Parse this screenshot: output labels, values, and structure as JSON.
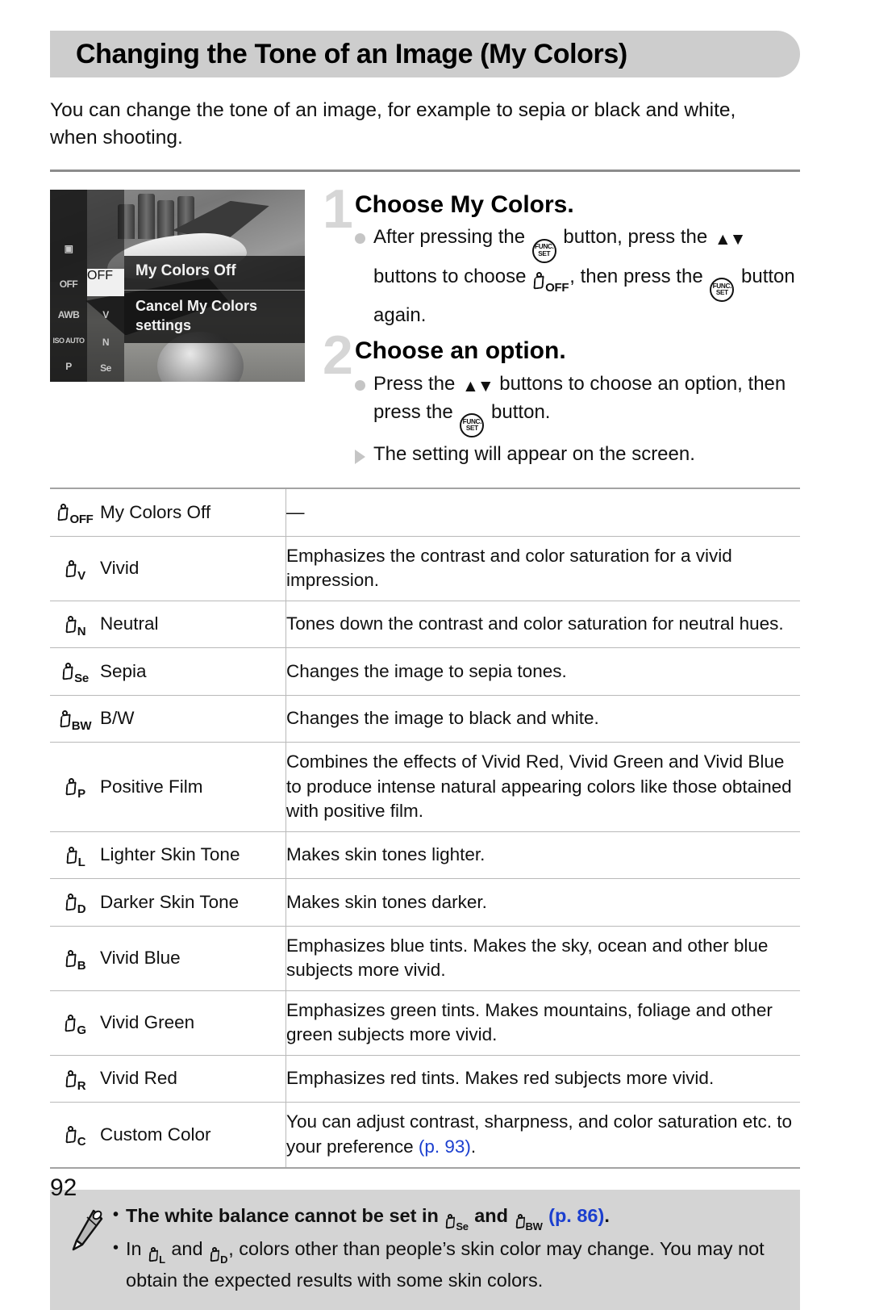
{
  "page": {
    "number": "92",
    "title": "Changing the Tone of an Image (My Colors)",
    "intro": "You can change the tone of an image, for example to sepia or black and white, when shooting."
  },
  "camera_screen": {
    "selected_label": "OFF",
    "menu_title": "My Colors Off",
    "menu_subtitle": "Cancel My Colors settings",
    "left_column_items": [
      "▣",
      "OFF",
      "AWB",
      "ISO AUTO",
      "P"
    ],
    "option_column_items": [
      "OFF",
      "V",
      "N",
      "Se"
    ]
  },
  "steps": [
    {
      "number": "1",
      "title": "Choose My Colors.",
      "bullets": [
        {
          "marker": "dot",
          "parts": [
            {
              "t": "text",
              "v": "After pressing the "
            },
            {
              "t": "funcset"
            },
            {
              "t": "text",
              "v": " button, press the "
            },
            {
              "t": "updown"
            },
            {
              "t": "text",
              "v": " buttons to choose "
            },
            {
              "t": "mc",
              "sub": "OFF"
            },
            {
              "t": "text",
              "v": ", then press the "
            },
            {
              "t": "funcset"
            },
            {
              "t": "text",
              "v": " button again."
            }
          ]
        }
      ]
    },
    {
      "number": "2",
      "title": "Choose an option.",
      "bullets": [
        {
          "marker": "dot",
          "parts": [
            {
              "t": "text",
              "v": "Press the "
            },
            {
              "t": "updown"
            },
            {
              "t": "text",
              "v": " buttons to choose an option, then press the "
            },
            {
              "t": "funcset"
            },
            {
              "t": "text",
              "v": " button."
            }
          ]
        },
        {
          "marker": "triangle",
          "parts": [
            {
              "t": "text",
              "v": "The setting will appear on the screen."
            }
          ]
        }
      ]
    }
  ],
  "table": {
    "rows": [
      {
        "icon_sub": "OFF",
        "name": "My Colors Off",
        "desc": "—"
      },
      {
        "icon_sub": "V",
        "name": "Vivid",
        "desc": "Emphasizes the contrast and color saturation for a vivid impression."
      },
      {
        "icon_sub": "N",
        "name": "Neutral",
        "desc": "Tones down the contrast and color saturation for neutral hues."
      },
      {
        "icon_sub": "Se",
        "name": "Sepia",
        "desc": "Changes the image to sepia tones."
      },
      {
        "icon_sub": "BW",
        "name": "B/W",
        "desc": "Changes the image to black and white."
      },
      {
        "icon_sub": "P",
        "name": "Positive Film",
        "desc": "Combines the effects of Vivid Red, Vivid Green and Vivid Blue to produce intense natural appearing colors like those obtained with positive film."
      },
      {
        "icon_sub": "L",
        "name": "Lighter Skin Tone",
        "desc": "Makes skin tones lighter."
      },
      {
        "icon_sub": "D",
        "name": "Darker Skin Tone",
        "desc": "Makes skin tones darker."
      },
      {
        "icon_sub": "B",
        "name": "Vivid Blue",
        "desc": "Emphasizes blue tints. Makes the sky, ocean and other blue subjects more vivid."
      },
      {
        "icon_sub": "G",
        "name": "Vivid Green",
        "desc": "Emphasizes green tints. Makes mountains, foliage and other green subjects more vivid."
      },
      {
        "icon_sub": "R",
        "name": "Vivid Red",
        "desc": "Emphasizes red tints. Makes red subjects more vivid."
      },
      {
        "icon_sub": "C",
        "name": "Custom Color",
        "desc_pre": "You can adjust contrast, sharpness, and color saturation etc. to your preference ",
        "desc_ref": "(p. 93)",
        "desc_post": "."
      }
    ]
  },
  "note": {
    "icon": "pencil-icon",
    "items": [
      {
        "bold": true,
        "parts": [
          {
            "t": "text",
            "v": "The white balance cannot be set in "
          },
          {
            "t": "mc",
            "sub": "Se"
          },
          {
            "t": "text",
            "v": " and "
          },
          {
            "t": "mc",
            "sub": "BW"
          },
          {
            "t": "text",
            "v": " "
          },
          {
            "t": "ref",
            "v": "(p. 86)"
          },
          {
            "t": "text",
            "v": "."
          }
        ]
      },
      {
        "bold": false,
        "parts": [
          {
            "t": "text",
            "v": "In "
          },
          {
            "t": "mc",
            "sub": "L"
          },
          {
            "t": "text",
            "v": " and "
          },
          {
            "t": "mc",
            "sub": "D"
          },
          {
            "t": "text",
            "v": ", colors other than people’s skin color may change. You may not obtain the expected results with some skin colors."
          }
        ]
      }
    ]
  },
  "colors": {
    "title_bar_bg": "#cdcdcd",
    "note_bg": "#d4d4d4",
    "rule": "#8c8c8c",
    "table_border": "#b9b9b9",
    "step_number": "#d6d6d6",
    "bullet_marker": "#c5c5c5",
    "page_ref_link": "#1b3fcf"
  }
}
